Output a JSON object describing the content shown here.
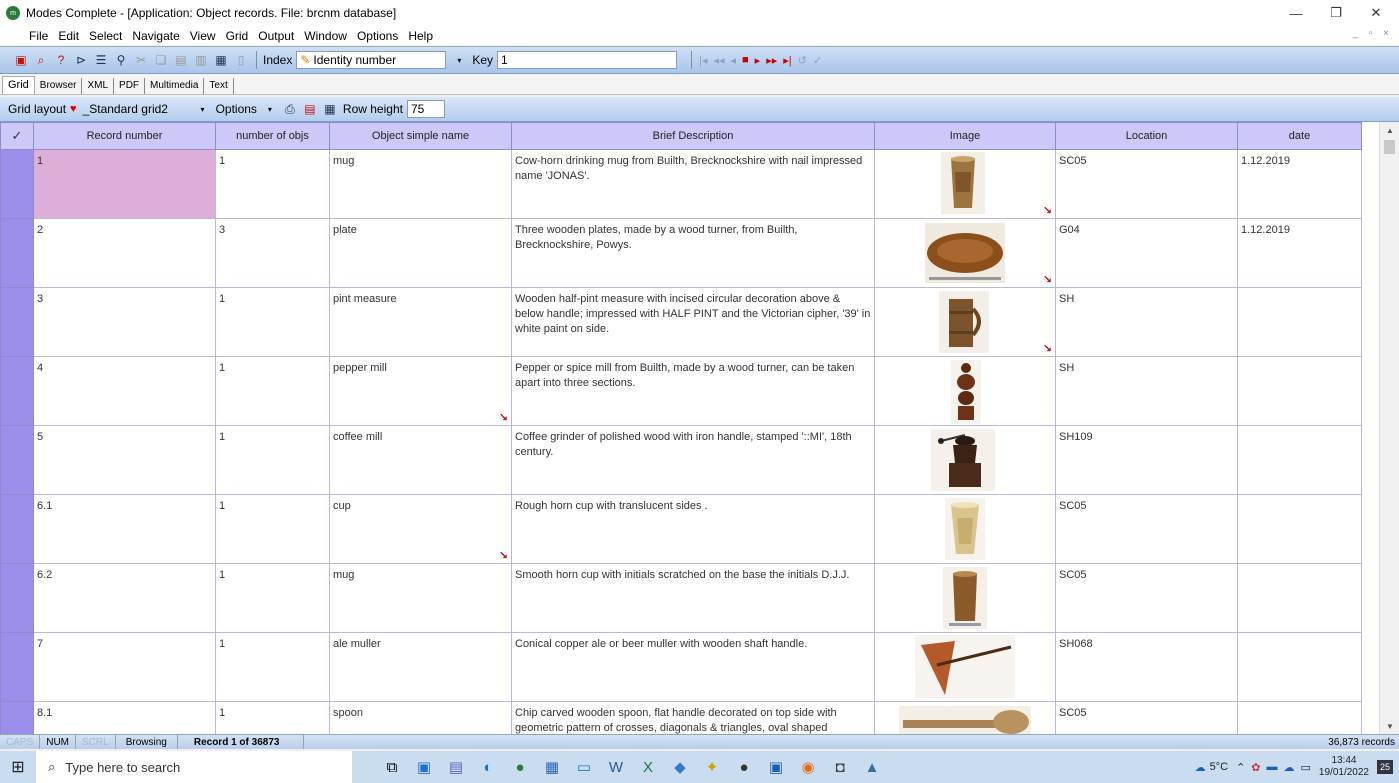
{
  "window": {
    "title": "Modes Complete - [Application: Object records. File: brcnm database]",
    "controls": {
      "minimize": "—",
      "restore": "❐",
      "close": "✕"
    }
  },
  "menu": [
    "File",
    "Edit",
    "Select",
    "Navigate",
    "View",
    "Grid",
    "Output",
    "Window",
    "Options",
    "Help"
  ],
  "toolbar": {
    "index_label": "Index",
    "index_value": "Identity number",
    "key_label": "Key",
    "key_value": "1"
  },
  "view_tabs": [
    "Grid",
    "Browser",
    "XML",
    "PDF",
    "Multimedia",
    "Text"
  ],
  "gridbar": {
    "layout_label": "Grid layout",
    "layout_value": "_Standard grid2",
    "options_label": "Options",
    "row_height_label": "Row height",
    "row_height_value": "75"
  },
  "grid": {
    "check_mark": "✓",
    "columns": [
      "Record number",
      "number of objs",
      "Object simple name",
      "Brief Description",
      "Image",
      "Location",
      "date"
    ],
    "rows": [
      {
        "record": "1",
        "objs": "1",
        "name": "mug",
        "desc": "Cow-horn drinking mug from Builth, Brecknockshire with nail impressed name 'JONAS'.",
        "location": "SC05",
        "date": "1.12.2019",
        "image": "horn-mug"
      },
      {
        "record": "2",
        "objs": "3",
        "name": "plate",
        "desc": "Three wooden plates, made by a wood turner, from Builth, Brecknockshire, Powys.",
        "location": "G04",
        "date": "1.12.2019",
        "image": "wooden-plate"
      },
      {
        "record": "3",
        "objs": "1",
        "name": "pint measure",
        "desc": "Wooden half-pint measure with incised circular decoration above & below handle; impressed with HALF PINT and the Victorian cipher, '39' in white paint on side.",
        "location": "SH",
        "date": "",
        "image": "pint-measure"
      },
      {
        "record": "4",
        "objs": "1",
        "name": "pepper mill",
        "desc": "Pepper or spice mill from Builth, made by a wood turner, can be taken apart into three sections.",
        "location": "SH",
        "date": "",
        "image": "pepper-mill"
      },
      {
        "record": "5",
        "objs": "1",
        "name": "coffee mill",
        "desc": "Coffee grinder of polished wood with iron handle, stamped '::MI', 18th century.",
        "location": "SH109",
        "date": "",
        "image": "coffee-mill"
      },
      {
        "record": "6.1",
        "objs": "1",
        "name": "cup",
        "desc": "Rough horn cup with translucent sides .",
        "location": "SC05",
        "date": "",
        "image": "horn-cup"
      },
      {
        "record": "6.2",
        "objs": "1",
        "name": "mug",
        "desc": "Smooth horn cup with initials scratched on the base the initials D.J.J.",
        "location": "SC05",
        "date": "",
        "image": "horn-mug-2"
      },
      {
        "record": "7",
        "objs": "1",
        "name": "ale muller",
        "desc": "Conical copper ale or beer muller with wooden shaft handle.",
        "location": "SH068",
        "date": "",
        "image": "ale-muller"
      },
      {
        "record": "8.1",
        "objs": "1",
        "name": "spoon",
        "desc": "Chip carved wooden spoon, flat handle decorated on top side with geometric pattern of crosses, diagonals & triangles, oval shaped",
        "location": "SC05",
        "date": "",
        "image": "wooden-spoon"
      }
    ]
  },
  "statusbar": {
    "caps": "CAPS",
    "num": "NUM",
    "scrl": "SCRL",
    "mode": "Browsing",
    "record": "Record 1 of 36873",
    "count": "36,873 records"
  },
  "taskbar": {
    "search_placeholder": "Type here to search",
    "weather": "5°C",
    "time": "13:44",
    "date": "19/01/2022",
    "notifications": "25"
  }
}
